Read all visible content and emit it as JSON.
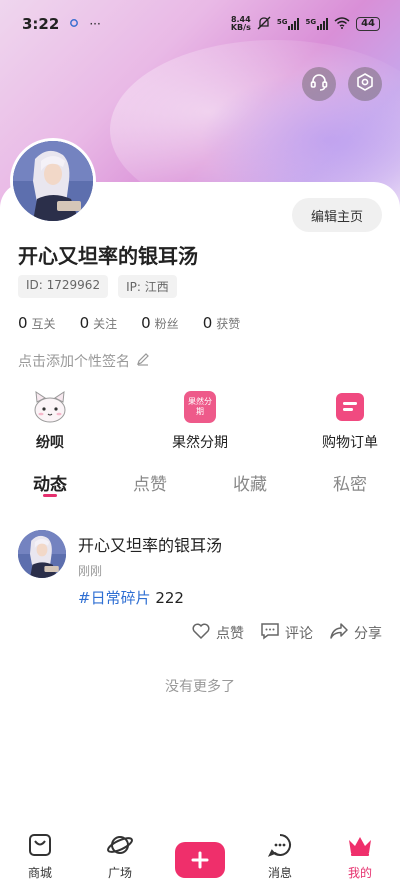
{
  "status": {
    "time": "3:22",
    "dots": "···",
    "net_speed_top": "8.44",
    "net_speed_bottom": "KB/s",
    "signal1": "5G",
    "signal2": "5G",
    "battery": "44"
  },
  "header": {
    "support_icon": "headset-icon",
    "settings_icon": "settings-hex-icon"
  },
  "profile": {
    "edit_label": "编辑主页",
    "name": "开心又坦率的银耳汤",
    "id_label": "ID: 1729962",
    "ip_label": "IP: 江西",
    "stats": [
      {
        "num": "0",
        "label": "互关"
      },
      {
        "num": "0",
        "label": "关注"
      },
      {
        "num": "0",
        "label": "粉丝"
      },
      {
        "num": "0",
        "label": "获赞"
      }
    ],
    "signature_placeholder": "点击添加个性签名"
  },
  "features": [
    {
      "label": "纷呗",
      "icon": "cat-mascot-icon"
    },
    {
      "label": "果然分期",
      "icon": "installment-icon",
      "icon_text": "果然分期"
    },
    {
      "label": "购物订单",
      "icon": "order-list-icon"
    }
  ],
  "tabs": [
    {
      "label": "动态",
      "active": true
    },
    {
      "label": "点赞",
      "active": false
    },
    {
      "label": "收藏",
      "active": false
    },
    {
      "label": "私密",
      "active": false
    }
  ],
  "post": {
    "author": "开心又坦率的银耳汤",
    "time": "刚刚",
    "tag": "#日常碎片",
    "text": " 222",
    "like_label": "点赞",
    "comment_label": "评论",
    "share_label": "分享"
  },
  "no_more": "没有更多了",
  "bottom_nav": [
    {
      "label": "商城",
      "icon": "shop-bag-icon"
    },
    {
      "label": "广场",
      "icon": "planet-icon"
    },
    {
      "label": "",
      "icon": "plus-icon"
    },
    {
      "label": "消息",
      "icon": "message-bubble-icon"
    },
    {
      "label": "我的",
      "icon": "crown-icon",
      "active": true
    }
  ],
  "colors": {
    "accent": "#e6306e",
    "tag_blue": "#2f6fd3"
  }
}
